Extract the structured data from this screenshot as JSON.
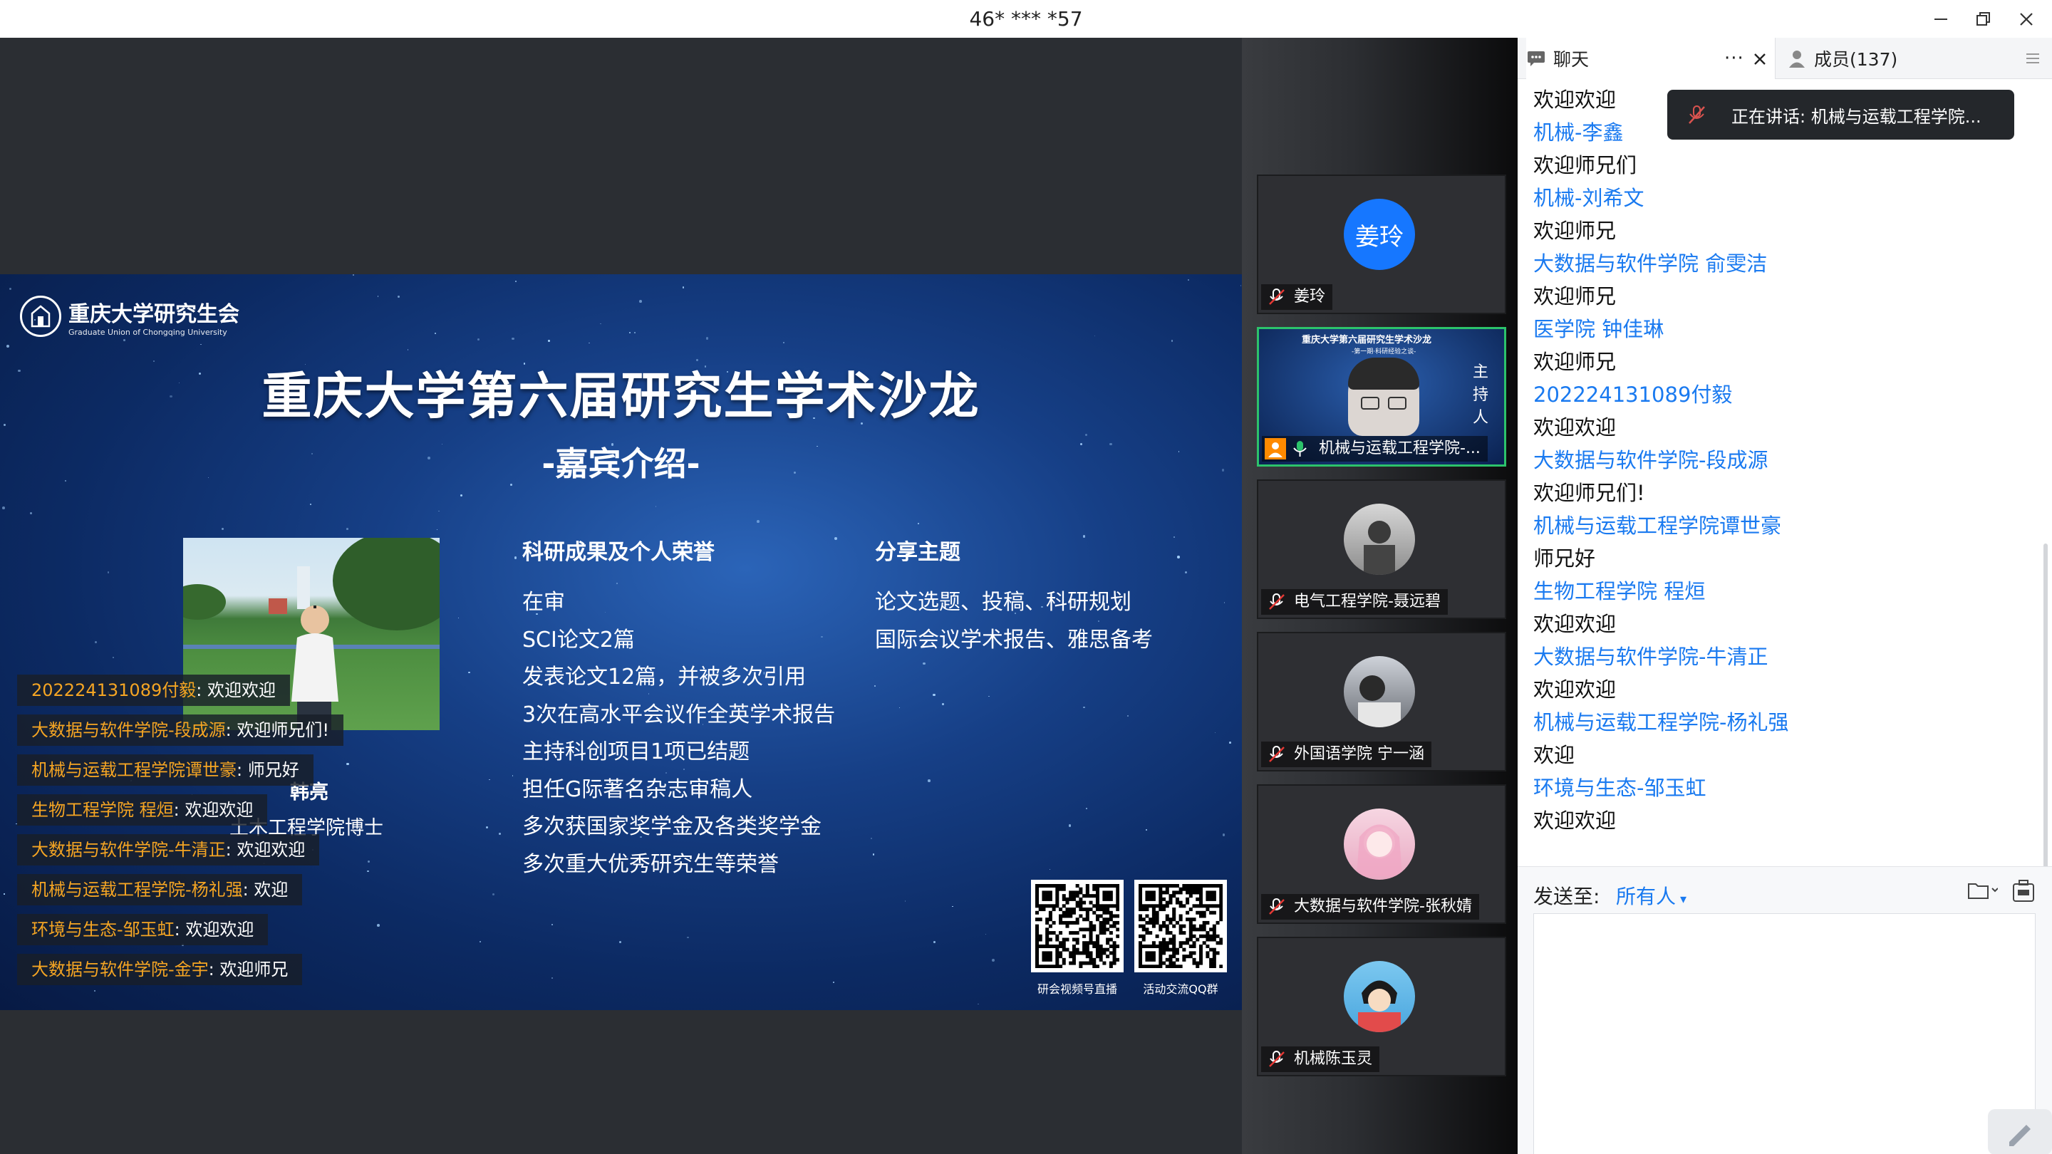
{
  "window": {
    "title": "46* *** *57",
    "minimize_icon": "minimize-icon",
    "restore_icon": "restore-icon",
    "close_icon": "close-icon"
  },
  "slide": {
    "org_name": "重庆大学研究生会",
    "org_name_en": "Graduate Union of Chongqing University",
    "title": "重庆大学第六届研究生学术沙龙",
    "subtitle": "-嘉宾介绍-",
    "guest_name": "韩亮",
    "guest_role": "土木工程学院博士",
    "honors_heading": "科研成果及个人荣誉",
    "honors": [
      "在审",
      "SCI论文2篇",
      "发表论文12篇，并被多次引用",
      "3次在高水平会议作全英学术报告",
      "主持科创项目1项已结题",
      "担任G际著名杂志审稿人",
      "多次获国家奖学金及各类奖学金",
      "多次重大优秀研究生等荣誉"
    ],
    "topics_heading": "分享主题",
    "topics": [
      "论文选题、投稿、科研规划",
      "国际会议学术报告、雅思备考"
    ],
    "qr_labels": [
      "研会视频号直播",
      "活动交流QQ群"
    ]
  },
  "danmaku": [
    {
      "who": "202224131089付毅",
      "msg": "欢迎欢迎"
    },
    {
      "who": "大数据与软件学院-段成源",
      "msg": "欢迎师兄们!"
    },
    {
      "who": "机械与运载工程学院谭世豪",
      "msg": "师兄好"
    },
    {
      "who": "生物工程学院 程烜",
      "msg": "欢迎欢迎"
    },
    {
      "who": "大数据与软件学院-牛清正",
      "msg": "欢迎欢迎"
    },
    {
      "who": "机械与运载工程学院-杨礼强",
      "msg": "欢迎"
    },
    {
      "who": "环境与生态-邹玉虹",
      "msg": "欢迎欢迎"
    },
    {
      "who": "大数据与软件学院-金宇",
      "msg": "欢迎师兄"
    }
  ],
  "participants": [
    {
      "name": "姜玲",
      "avatar_text": "姜玲",
      "mic": "muted"
    },
    {
      "name": "机械与运载工程学院-...",
      "avatar_text": "",
      "mic": "on",
      "active": true
    },
    {
      "name": "电气工程学院-聂远碧",
      "avatar_text": "",
      "mic": "muted"
    },
    {
      "name": "外国语学院 宁一涵",
      "avatar_text": "",
      "mic": "muted"
    },
    {
      "name": "大数据与软件学院-张秋婧",
      "avatar_text": "",
      "mic": "muted"
    },
    {
      "name": "机械陈玉灵",
      "avatar_text": "",
      "mic": "muted"
    }
  ],
  "share_thumb": {
    "title": "重庆大学第六届研究生学术沙龙",
    "subtitle": "-第一期·科研经验之谈-",
    "host_label": "主持人"
  },
  "panel": {
    "chat_tab": "聊天",
    "more": "···",
    "members_tab": "成员(137)",
    "speaking": "正在讲话: 机械与运载工程学院...",
    "chat": [
      {
        "type": "message",
        "text": "欢迎欢迎"
      },
      {
        "type": "sender",
        "text": "机械-李鑫"
      },
      {
        "type": "message",
        "text": "欢迎师兄们"
      },
      {
        "type": "sender",
        "text": "机械-刘希文"
      },
      {
        "type": "message",
        "text": "欢迎师兄"
      },
      {
        "type": "sender",
        "text": "大数据与软件学院 俞雯洁"
      },
      {
        "type": "message",
        "text": "欢迎师兄"
      },
      {
        "type": "sender",
        "text": "医学院 钟佳琳"
      },
      {
        "type": "message",
        "text": "欢迎师兄"
      },
      {
        "type": "sender",
        "text": "202224131089付毅"
      },
      {
        "type": "message",
        "text": "欢迎欢迎"
      },
      {
        "type": "sender",
        "text": "大数据与软件学院-段成源"
      },
      {
        "type": "message",
        "text": "欢迎师兄们!"
      },
      {
        "type": "sender",
        "text": "机械与运载工程学院谭世豪"
      },
      {
        "type": "message",
        "text": "师兄好"
      },
      {
        "type": "sender",
        "text": "生物工程学院 程烜"
      },
      {
        "type": "message",
        "text": "欢迎欢迎"
      },
      {
        "type": "sender",
        "text": "大数据与软件学院-牛清正"
      },
      {
        "type": "message",
        "text": "欢迎欢迎"
      },
      {
        "type": "sender",
        "text": "机械与运载工程学院-杨礼强"
      },
      {
        "type": "message",
        "text": "欢迎"
      },
      {
        "type": "sender",
        "text": "环境与生态-邹玉虹"
      },
      {
        "type": "message",
        "text": "欢迎欢迎"
      }
    ],
    "send_to_label": "发送至:",
    "send_to_value": "所有人",
    "input_value": "",
    "input_placeholder": ""
  },
  "colors": {
    "accent": "#1a7af0",
    "danmaku_name": "#f5a523",
    "active_speaker": "#2cc36b",
    "stage_bg": "#2b2e33"
  }
}
